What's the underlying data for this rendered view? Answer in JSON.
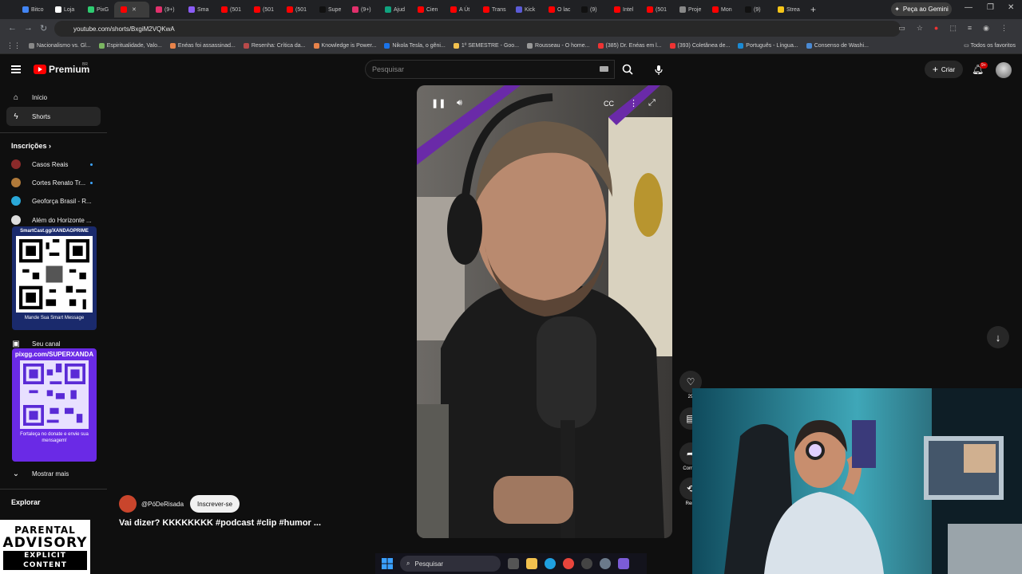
{
  "browser": {
    "tabs": [
      {
        "label": "Bitco",
        "color": "#4285f4"
      },
      {
        "label": "Loja",
        "color": "#ffffff"
      },
      {
        "label": "PixG",
        "color": "#2ecc71"
      },
      {
        "label": "",
        "color": "#ff0000",
        "active": true
      },
      {
        "label": "(9+)",
        "color": "#e1306c"
      },
      {
        "label": "Sma",
        "color": "#8b5cf6"
      },
      {
        "label": "(501",
        "color": "#ff0000"
      },
      {
        "label": "(501",
        "color": "#ff0000"
      },
      {
        "label": "(501",
        "color": "#ff0000"
      },
      {
        "label": "Supe",
        "color": "#111111"
      },
      {
        "label": "(9+)",
        "color": "#e1306c"
      },
      {
        "label": "Ajud",
        "color": "#10a37f"
      },
      {
        "label": "Cien",
        "color": "#ff0000"
      },
      {
        "label": "A Út",
        "color": "#ff0000"
      },
      {
        "label": "Trans",
        "color": "#ff0000"
      },
      {
        "label": "Kick",
        "color": "#5b5bd6"
      },
      {
        "label": "O lac",
        "color": "#ff0000"
      },
      {
        "label": "(9)",
        "color": "#111111"
      },
      {
        "label": "Intel",
        "color": "#ff0000"
      },
      {
        "label": "(501",
        "color": "#ff0000"
      },
      {
        "label": "Proje",
        "color": "#888888"
      },
      {
        "label": "Mon",
        "color": "#ff0000"
      },
      {
        "label": "(9)",
        "color": "#111111"
      },
      {
        "label": "Strea",
        "color": "#f5c518"
      }
    ],
    "gemini_label": "Peça ao Gemini",
    "url": "youtube.com/shorts/BxgiM2VQKwA",
    "bookmarks": [
      "Nacionalismo vs. Gl...",
      "Espiritualidade, Valo...",
      "Enéas foi assassinad...",
      "Resenha: Crítica da...",
      "Knowledge is Power...",
      "Nikola Tesla, o gêni...",
      "1º SEMESTRE - Goo...",
      "Rousseau - O home...",
      "(385) Dr. Enéas em l...",
      "(393) Coletânea de...",
      "Português - Língua...",
      "Consenso de Washi..."
    ],
    "all_favorites": "Todos os favoritos"
  },
  "youtube": {
    "logo_text": "Premium",
    "logo_region": "BR",
    "search_placeholder": "Pesquisar",
    "create_label": "Criar",
    "notif_count": "9+",
    "sidebar": {
      "home": "Início",
      "shorts": "Shorts",
      "subscriptions_header": "Inscrições",
      "subscriptions": [
        "Casos Reais",
        "Cortes Renato Tr...",
        "Geoforça Brasil - R...",
        "Além do Horizonte ..."
      ],
      "your_channel": "Seu canal",
      "show_more": "Mostrar mais",
      "explore_header": "Explorar"
    },
    "short": {
      "channel": "@PóDeRisada",
      "subscribe": "Inscrever-se",
      "caption": "Vai dizer? KKKKKKKK #podcast #clip  #humor ...",
      "like_count": "29",
      "share_label": "Compa",
      "remix_label": "Rem"
    }
  },
  "overlays": {
    "qr1_title": "SmartCast.gg/XANDAOPRIME",
    "qr1_caption": "Mande Sua Smart Message",
    "qr2_title": "pixgg.com/SUPERXANDA",
    "qr2_caption": "Fortaleça no donate e envie sua mensagem!",
    "advisory_1": "PARENTAL",
    "advisory_2": "ADVISORY",
    "advisory_3": "EXPLICIT CONTENT"
  },
  "taskbar": {
    "search_label": "Pesquisar"
  }
}
